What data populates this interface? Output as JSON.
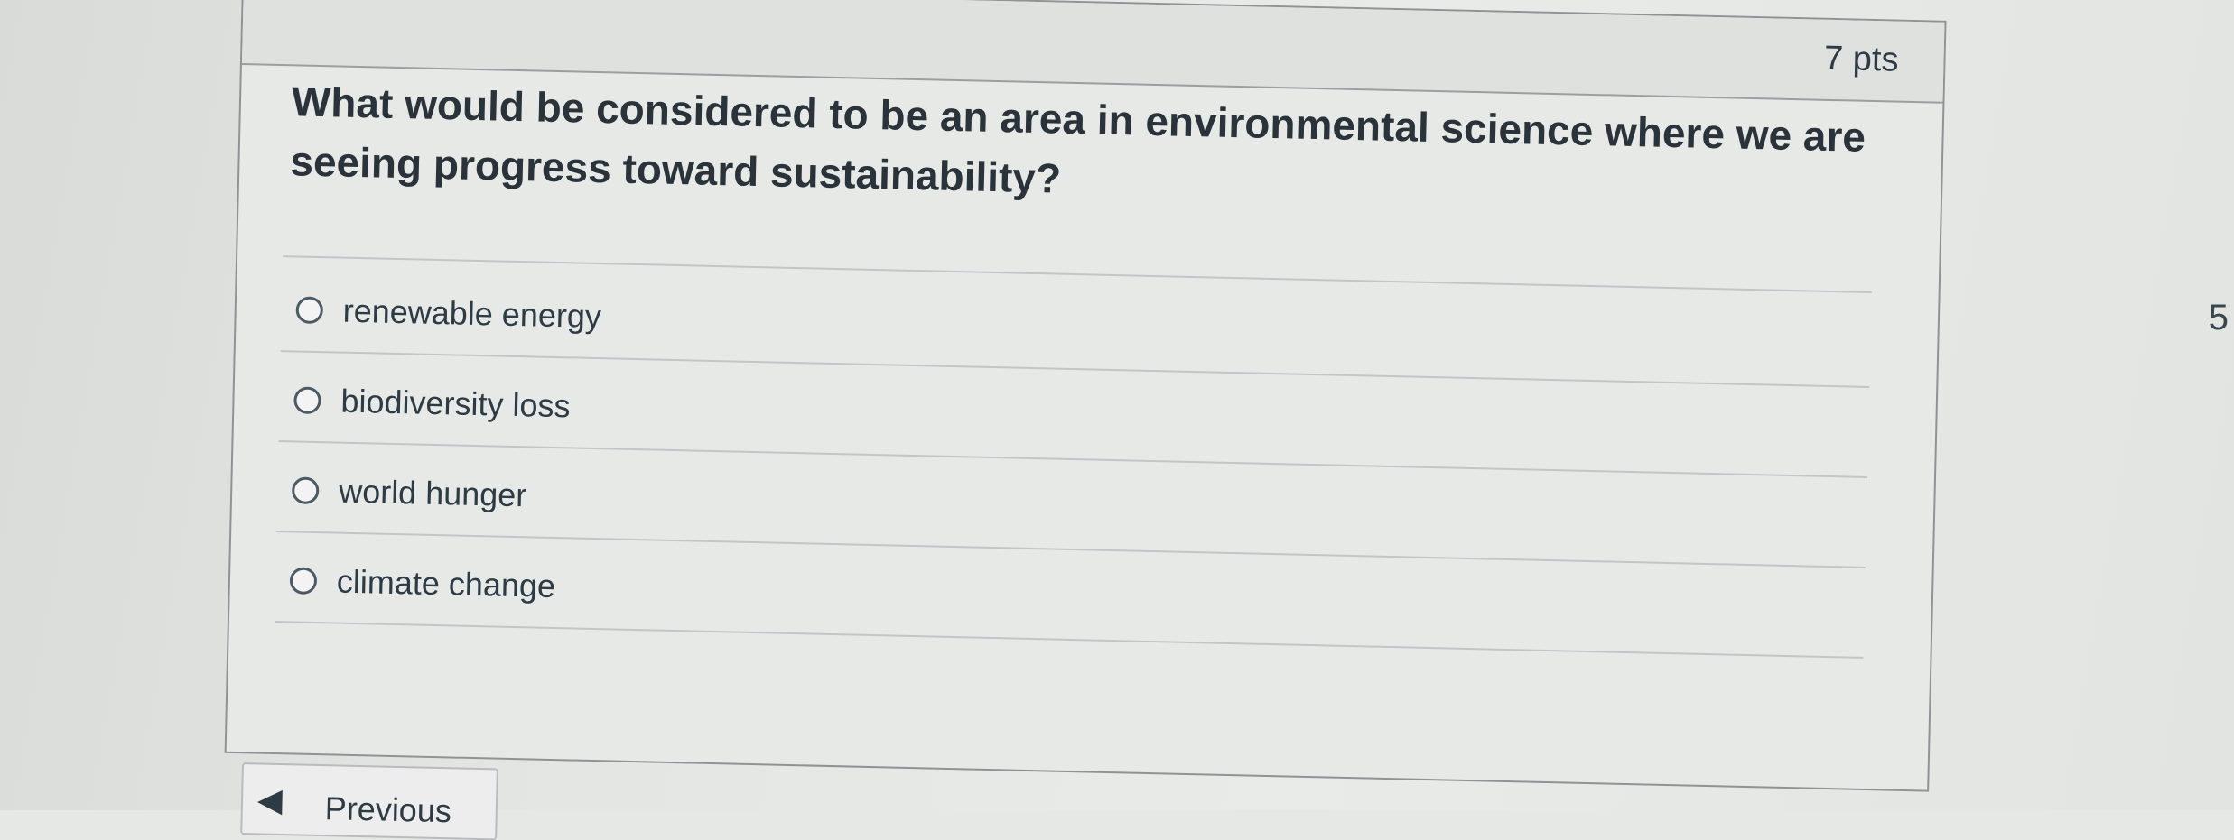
{
  "question": {
    "points": "7 pts",
    "text": "What would be considered to be an area in environmental science where we are seeing progress toward sustainability?",
    "answers": [
      {
        "label": "renewable energy"
      },
      {
        "label": "biodiversity loss"
      },
      {
        "label": "world hunger"
      },
      {
        "label": "climate change"
      }
    ]
  },
  "navigation": {
    "previous_label": "Previous",
    "previous_arrow": "◀"
  },
  "edge": {
    "glyph": "5"
  }
}
